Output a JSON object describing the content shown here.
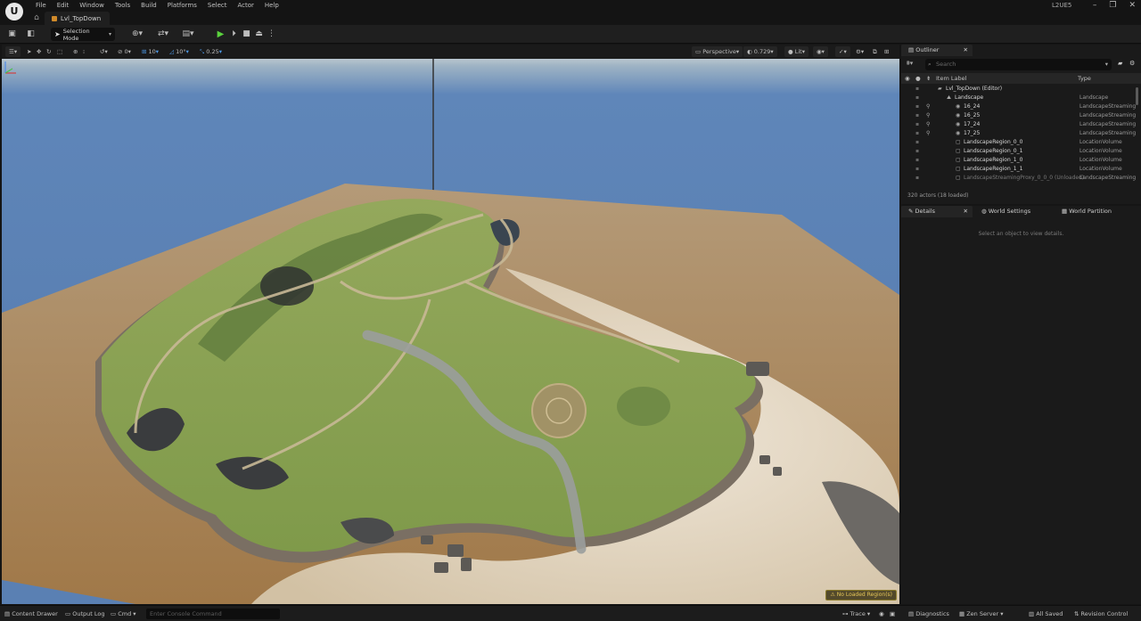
{
  "title_bar": {
    "logo_text": "U",
    "menu": [
      "File",
      "Edit",
      "Window",
      "Tools",
      "Build",
      "Platforms",
      "Select",
      "Actor",
      "Help"
    ],
    "level_tab": "Lvl_TopDown",
    "project_name": "L2UE5",
    "window_controls": [
      "–",
      "❐",
      "✕"
    ]
  },
  "toolbar": {
    "selection_mode": "Selection Mode"
  },
  "viewport_toolbar": {
    "rotate_snap": "0",
    "grid_snap": "10",
    "angle_snap": "10°",
    "scale_snap": "0.25",
    "view_mode": "Perspective",
    "fov": "0.729",
    "lighting": "Lit"
  },
  "viewport": {
    "notice": "No Loaded Region(s)",
    "colors": {
      "sky": "#5a80b3",
      "sand_plane": "#a9855b",
      "grass": "#8aa456",
      "rock": "#6e6b68",
      "dune": "#e6dccc"
    }
  },
  "outliner": {
    "tab_label": "Outliner",
    "search_placeholder": "Search",
    "columns": [
      "Item Label",
      "Type"
    ],
    "rows": [
      {
        "name": "Lvl_TopDown (Editor)",
        "type": "",
        "indent": 1
      },
      {
        "name": "Landscape",
        "type": "Landscape",
        "indent": 2
      },
      {
        "name": "16_24",
        "type": "LandscapeStreaming",
        "indent": 3
      },
      {
        "name": "16_25",
        "type": "LandscapeStreaming",
        "indent": 3
      },
      {
        "name": "17_24",
        "type": "LandscapeStreaming",
        "indent": 3
      },
      {
        "name": "17_25",
        "type": "LandscapeStreaming",
        "indent": 3
      },
      {
        "name": "LandscapeRegion_0_0",
        "type": "LocationVolume",
        "indent": 3
      },
      {
        "name": "LandscapeRegion_0_1",
        "type": "LocationVolume",
        "indent": 3
      },
      {
        "name": "LandscapeRegion_1_0",
        "type": "LocationVolume",
        "indent": 3
      },
      {
        "name": "LandscapeRegion_1_1",
        "type": "LocationVolume",
        "indent": 3
      },
      {
        "name": "LandscapeStreamingProxy_0_0_0 (Unloaded)",
        "type": "LandscapeStreaming",
        "indent": 3,
        "dim": true
      }
    ],
    "actor_count": "320 actors (18 loaded)"
  },
  "details": {
    "tabs": [
      "Details",
      "World Settings",
      "World Partition"
    ],
    "empty_message": "Select an object to view details."
  },
  "status_bar": {
    "content_drawer": "Content Drawer",
    "output_log": "Output Log",
    "cmd": "Cmd",
    "console_placeholder": "Enter Console Command",
    "trace": "Trace",
    "diagnostics": "Diagnostics",
    "zen_server": "Zen Server",
    "all_saved": "All Saved",
    "revision_control": "Revision Control"
  }
}
